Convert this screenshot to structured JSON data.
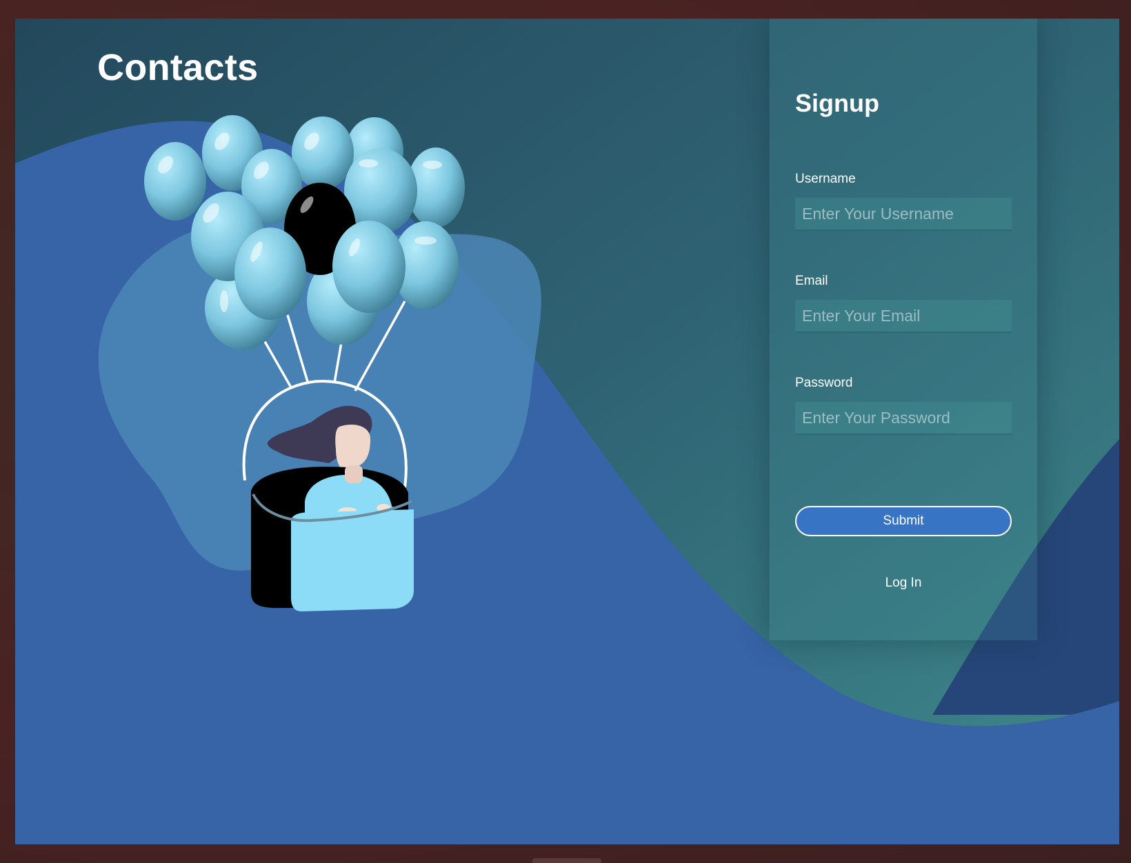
{
  "page": {
    "title": "Contacts"
  },
  "signup": {
    "title": "Signup",
    "username": {
      "label": "Username",
      "placeholder": "Enter Your Username",
      "value": ""
    },
    "email": {
      "label": "Email",
      "placeholder": "Enter Your Email",
      "value": ""
    },
    "password": {
      "label": "Password",
      "placeholder": "Enter Your Password",
      "value": ""
    },
    "submit_label": "Submit",
    "login_label": "Log In"
  },
  "illustration": {
    "subject": "woman-in-balloon-basket-illustration",
    "balloon_color": "#8ad9f4",
    "accent_balloon_color": "#000000"
  },
  "colors": {
    "background_dark": "#23485c",
    "background_teal": "#3b8087",
    "wave_blue": "#3764a7",
    "button_blue": "#3874c4",
    "text": "#ffffff"
  }
}
